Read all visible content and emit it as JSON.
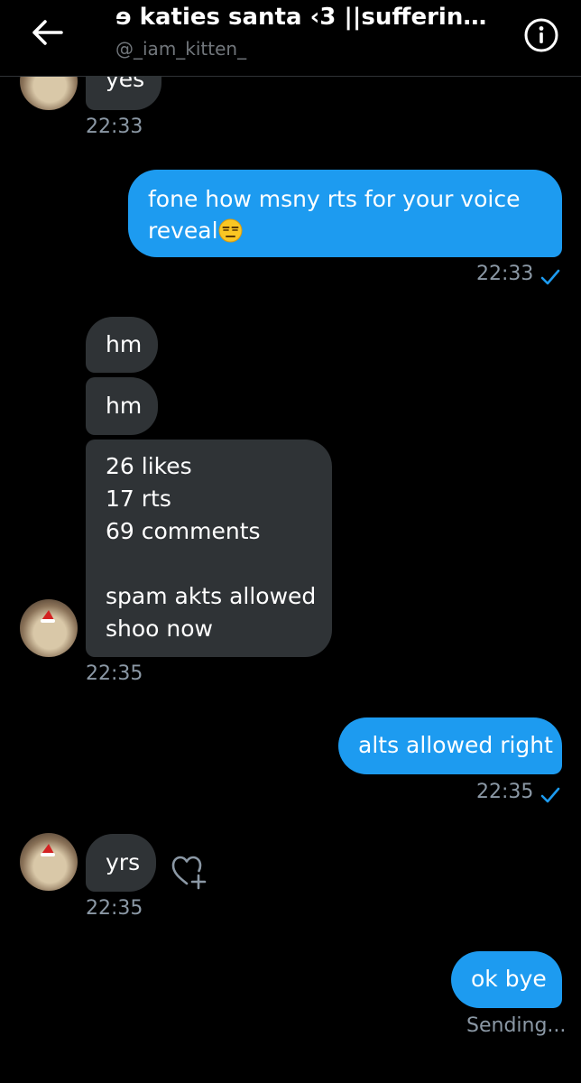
{
  "header": {
    "title": "ɘ katies santa ‹3 ||sufferin…",
    "handle": "@_iam_kitten_"
  },
  "icons": {
    "back": "back-arrow-icon",
    "info": "info-icon",
    "sent": "checkmark-icon",
    "react": "add-reaction-heart-icon"
  },
  "colors": {
    "background": "#000000",
    "incoming_bubble": "#2f3336",
    "outgoing_bubble": "#1d9bf0",
    "timestamp": "#8b98a5"
  },
  "messages": {
    "m1": {
      "text": "yes",
      "time": "22:33"
    },
    "m2": {
      "line1": "fone how msny rts for your voice",
      "line2": "reveal",
      "emoji": "😒",
      "time": "22:33"
    },
    "m3": {
      "text": "hm"
    },
    "m4": {
      "text": "hm"
    },
    "m5": {
      "lines": [
        "26 likes",
        "17 rts",
        "69 comments",
        "",
        "spam akts allowed",
        "shoo now"
      ],
      "time": "22:35"
    },
    "m6": {
      "text": "alts allowed right",
      "time": "22:35"
    },
    "m7": {
      "text": "yrs",
      "time": "22:35"
    },
    "m8": {
      "text": "ok bye",
      "status": "Sending..."
    }
  }
}
